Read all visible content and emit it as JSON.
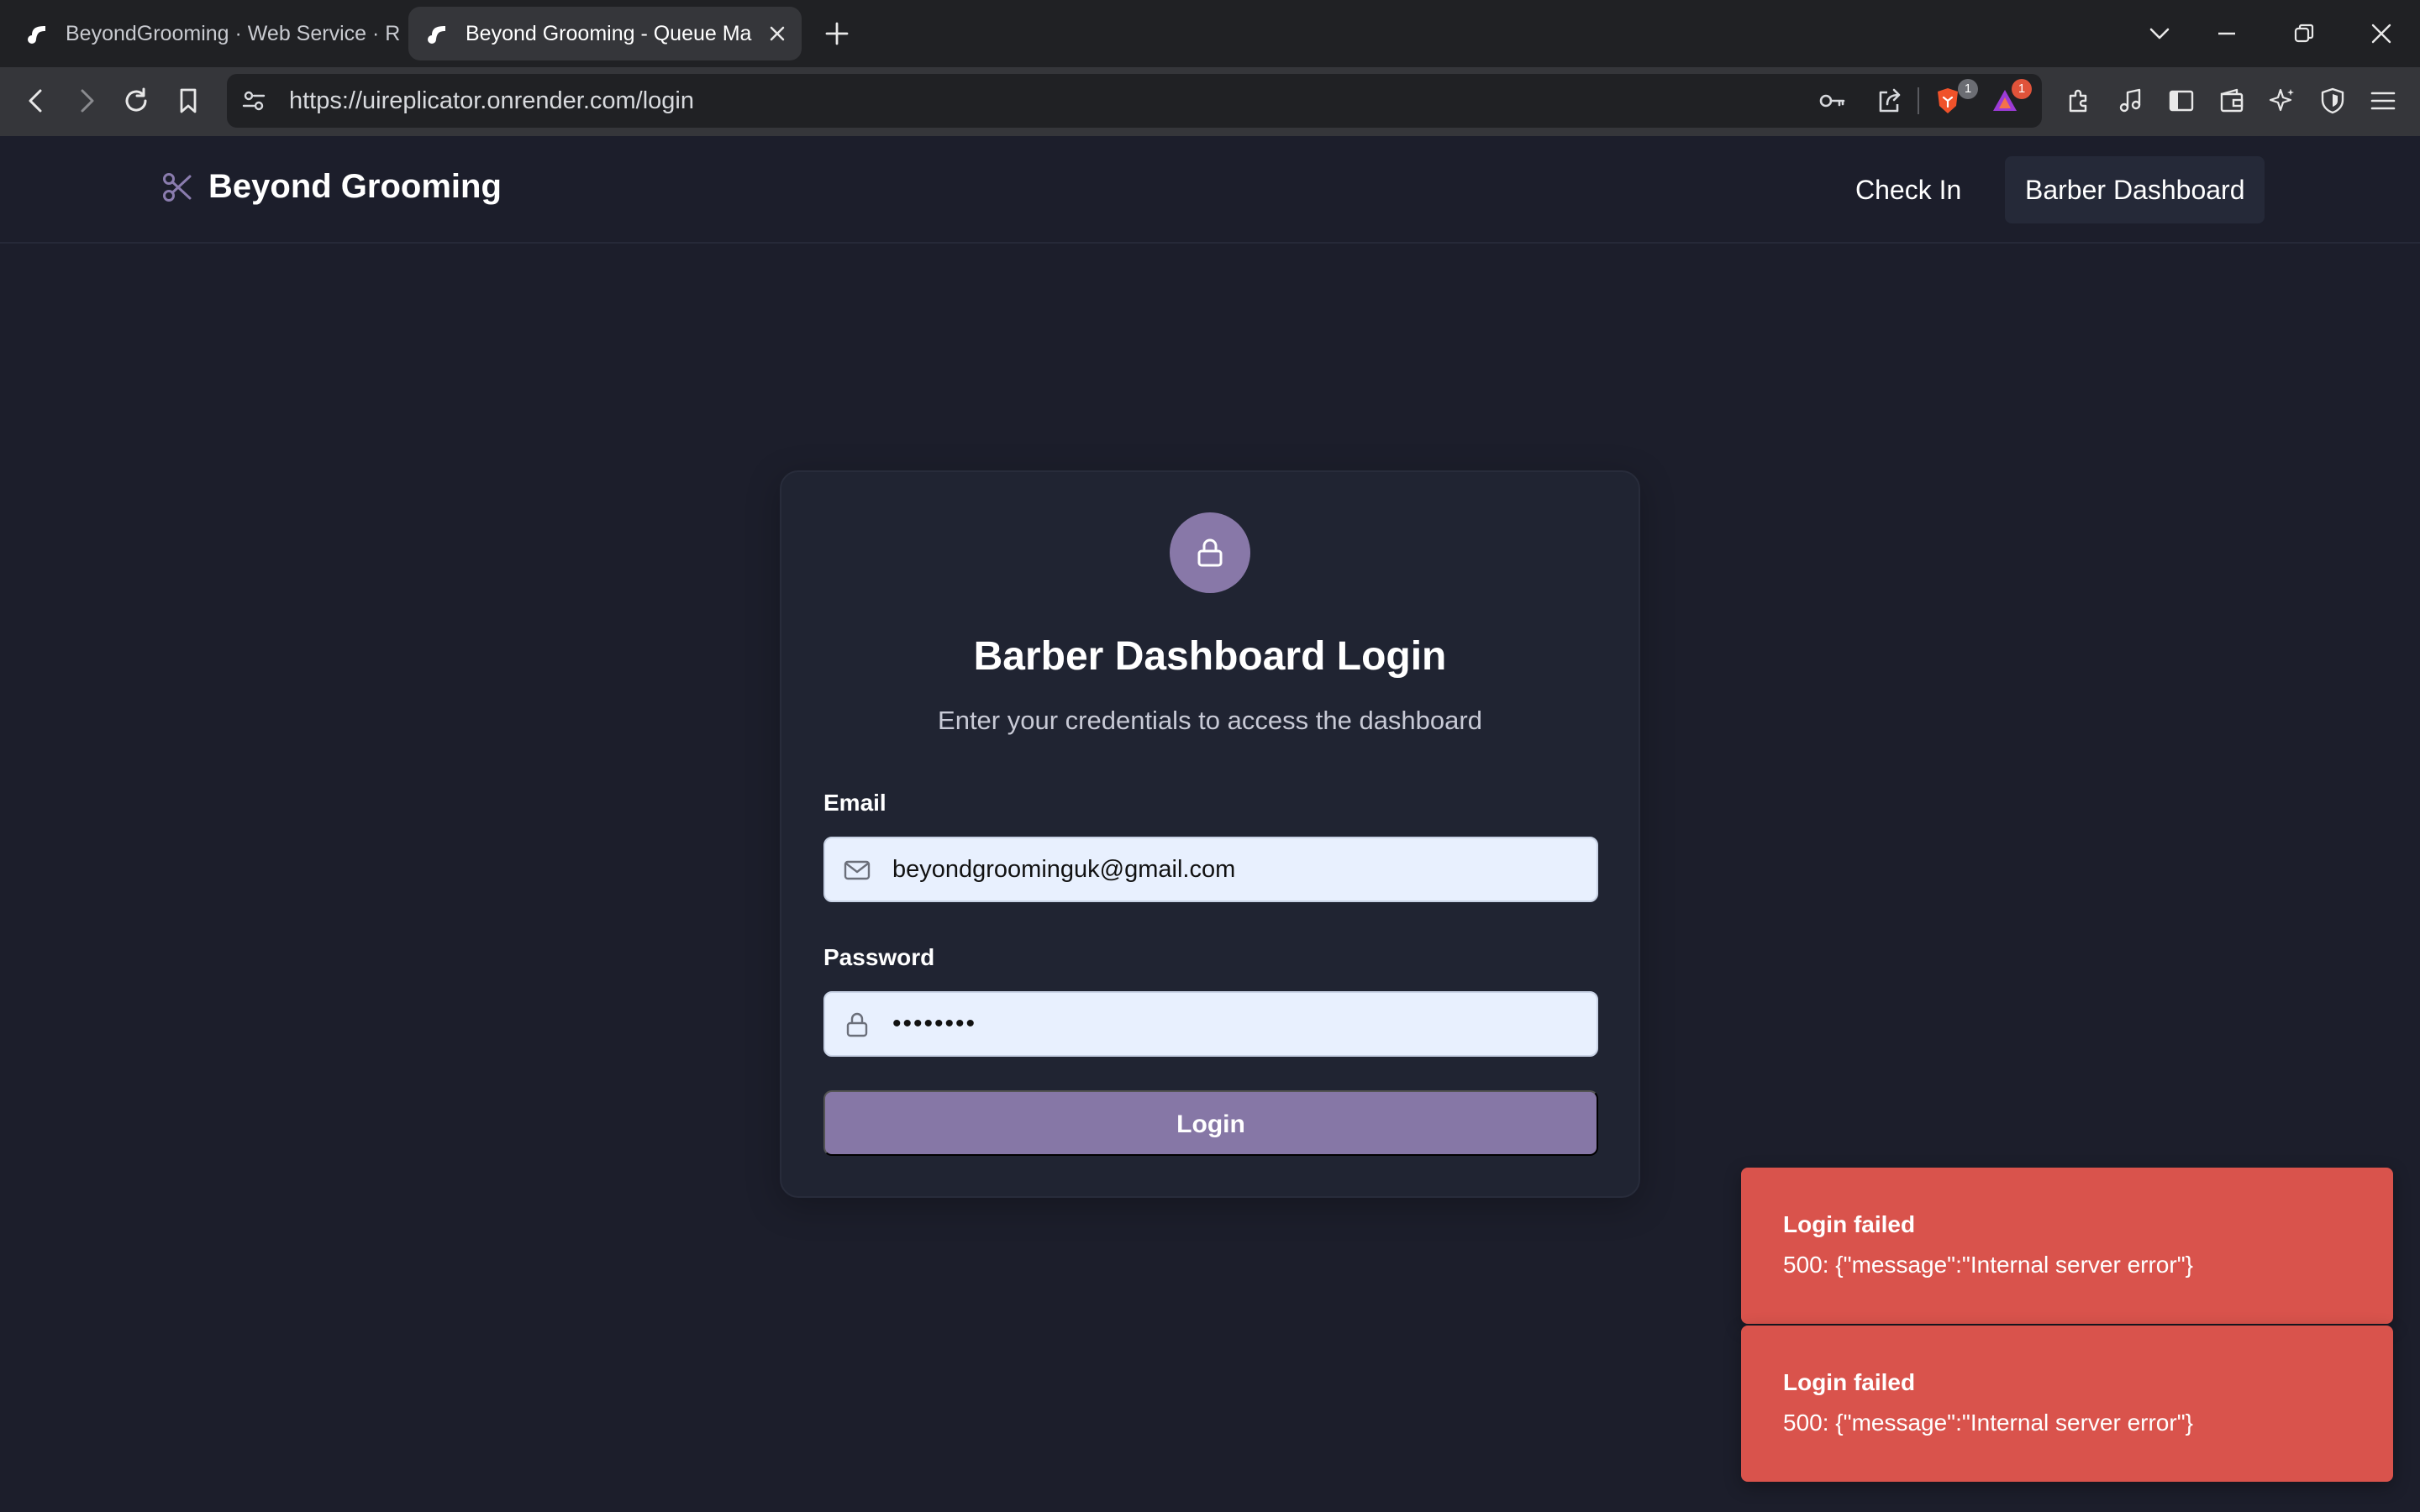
{
  "browser": {
    "tabs": [
      {
        "title": "BeyondGrooming · Web Service · R",
        "active": false
      },
      {
        "title": "Beyond Grooming - Queue Ma",
        "active": true
      }
    ],
    "url": "https://uireplicator.onrender.com/login",
    "badges": {
      "brave_shields": "1",
      "rewards": "1"
    }
  },
  "header": {
    "brand_name": "Beyond Grooming",
    "brand_icon": "scissors-icon",
    "nav": {
      "check_in": "Check In",
      "barber_dashboard": "Barber Dashboard"
    }
  },
  "login": {
    "icon": "lock-icon",
    "title": "Barber Dashboard Login",
    "subtitle": "Enter your credentials to access the dashboard",
    "email_label": "Email",
    "email_value": "beyondgroominguk@gmail.com",
    "password_label": "Password",
    "password_value": "••••••••",
    "submit_label": "Login"
  },
  "toasts": [
    {
      "title": "Login failed",
      "message": "500: {\"message\":\"Internal server error\"}"
    },
    {
      "title": "Login failed",
      "message": "500: {\"message\":\"Internal server error\"}"
    }
  ],
  "colors": {
    "page_bg": "#1c1e2b",
    "card_bg": "#202432",
    "accent": "#8677a6",
    "input_bg": "#e8f0fe",
    "toast_bg": "#d9534c"
  }
}
